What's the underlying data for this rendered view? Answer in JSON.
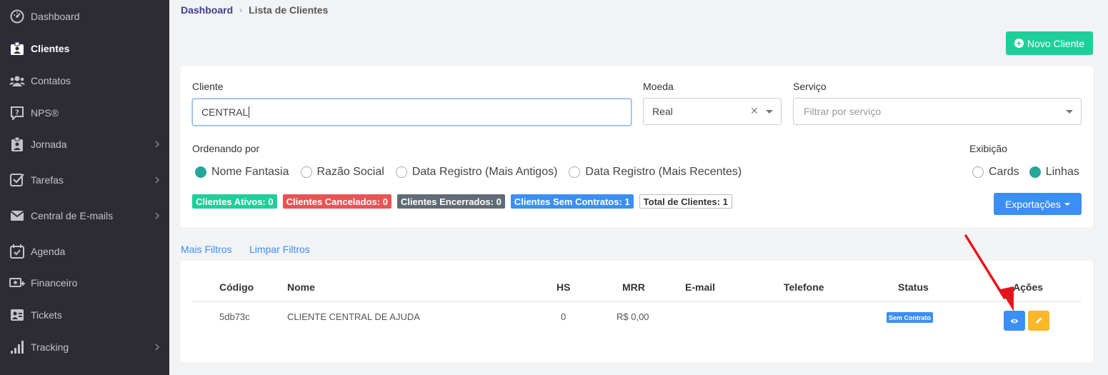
{
  "sidebar": {
    "items": [
      {
        "label": "Dashboard",
        "icon": "dashboard-icon"
      },
      {
        "label": "Clientes",
        "icon": "client-badge-icon",
        "active": true
      },
      {
        "label": "Contatos",
        "icon": "users-icon"
      },
      {
        "label": "NPS®",
        "icon": "question-bubble-icon"
      },
      {
        "label": "Jornada",
        "icon": "clipboard-user-icon"
      },
      {
        "label": "Tarefas",
        "icon": "checkbox-icon"
      },
      {
        "label": "Central de E-mails",
        "icon": "envelope-icon"
      },
      {
        "label": "Agenda",
        "icon": "calendar-check-icon"
      },
      {
        "label": "Financeiro",
        "icon": "money-plus-icon"
      },
      {
        "label": "Tickets",
        "icon": "ticket-user-icon"
      },
      {
        "label": "Tracking",
        "icon": "signal-bars-icon"
      }
    ]
  },
  "breadcrumb": {
    "home": "Dashboard",
    "separator": "›",
    "current": "Lista de Clientes"
  },
  "actions": {
    "new_client": "Novo Cliente",
    "export": "Exportações"
  },
  "filters": {
    "client_label": "Cliente",
    "client_value": "CENTRAL",
    "currency_label": "Moeda",
    "currency_value": "Real",
    "service_label": "Serviço",
    "service_placeholder": "Filtrar por serviço",
    "sort_label": "Ordenando por",
    "sort_options": [
      "Nome Fantasia",
      "Razão Social",
      "Data Registro (Mais Antigos)",
      "Data Registro (Mais Recentes)"
    ],
    "sort_selected": "Nome Fantasia",
    "display_label": "Exibição",
    "display_options": [
      "Cards",
      "Linhas"
    ],
    "display_selected": "Linhas",
    "more_filters": "Mais Filtros",
    "clear_filters": "Limpar Filtros"
  },
  "counters": [
    {
      "label": "Clientes Ativos: 0",
      "color": "#1fcf9a"
    },
    {
      "label": "Clientes Cancelados: 0",
      "color": "#e85454"
    },
    {
      "label": "Clientes Encerrados: 0",
      "color": "#616b75"
    },
    {
      "label": "Clientes Sem Contratos: 1",
      "color": "#3b8ff4"
    },
    {
      "label": "Total de Clientes: 1",
      "color": "#ffffff"
    }
  ],
  "table": {
    "headers": [
      "Código",
      "Nome",
      "HS",
      "MRR",
      "E-mail",
      "Telefone",
      "Status",
      "Ações"
    ],
    "rows": [
      {
        "code": "5db73c",
        "name": "CLIENTE CENTRAL DE AJUDA",
        "hs": "0",
        "mrr": "R$ 0,00",
        "email": "",
        "phone": "",
        "status": "Sem Contrato"
      }
    ]
  },
  "colors": {
    "sidebar_bg": "#2d2c35",
    "accent_green": "#1fcf9a",
    "accent_blue": "#3b8ff4",
    "accent_yellow": "#fbb728",
    "radio_checked": "#26a69a",
    "annotation_arrow": "#e8141c"
  }
}
